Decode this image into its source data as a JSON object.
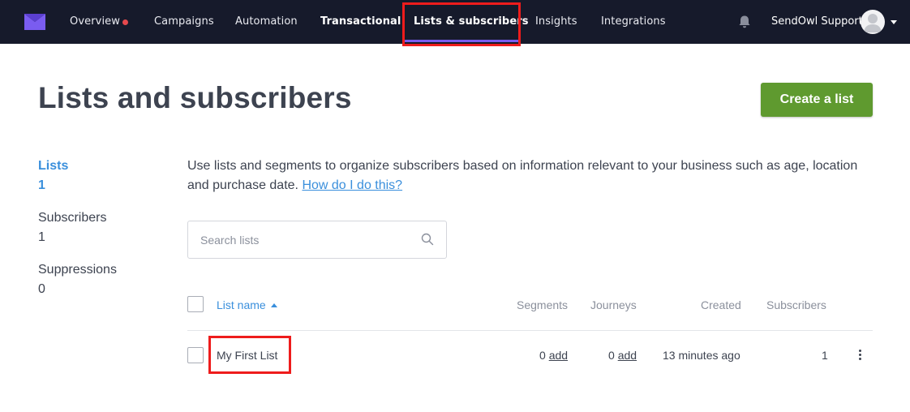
{
  "nav": {
    "items": [
      {
        "label": "Overview"
      },
      {
        "label": "Campaigns"
      },
      {
        "label": "Automation"
      },
      {
        "label": "Transactional"
      },
      {
        "label": "Lists & subscribers"
      },
      {
        "label": "Insights"
      },
      {
        "label": "Integrations"
      }
    ],
    "active": "Lists & subscribers",
    "user_name": "SendOwl Support"
  },
  "page": {
    "title": "Lists and subscribers",
    "create_button": "Create a list"
  },
  "sidebar": {
    "items": [
      {
        "label": "Lists",
        "count": "1",
        "active": true
      },
      {
        "label": "Subscribers",
        "count": "1",
        "active": false
      },
      {
        "label": "Suppressions",
        "count": "0",
        "active": false
      }
    ]
  },
  "intro": {
    "text": "Use lists and segments to organize subscribers based on information relevant to your business such as age, location and purchase date.",
    "link": "How do I do this?"
  },
  "search": {
    "placeholder": "Search lists",
    "value": ""
  },
  "table": {
    "columns": [
      "List name",
      "Segments",
      "Journeys",
      "Created",
      "Subscribers"
    ],
    "rows": [
      {
        "name": "My First List",
        "segments_count": "0",
        "segments_action": "add",
        "journeys_count": "0",
        "journeys_action": "add",
        "created": "13 minutes ago",
        "subscribers": "1"
      }
    ]
  },
  "colors": {
    "nav_bg": "#161a2b",
    "accent_purple": "#7a5cf0",
    "link_blue": "#3a8fdc",
    "primary_green": "#5f9a2f",
    "highlight_red": "#ee1c1c"
  }
}
